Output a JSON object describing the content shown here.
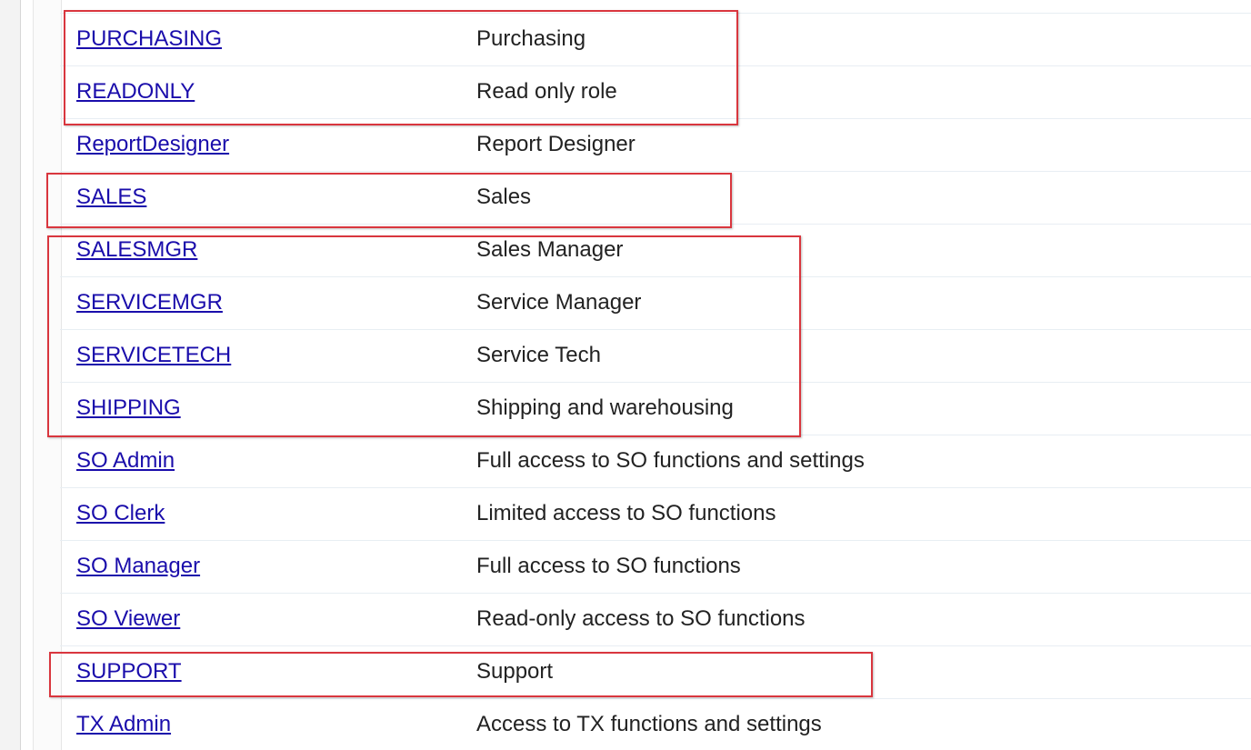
{
  "table": {
    "rows": [
      {
        "role": "PURCHASING",
        "description": "Purchasing"
      },
      {
        "role": "READONLY",
        "description": "Read only role"
      },
      {
        "role": "ReportDesigner",
        "description": "Report Designer"
      },
      {
        "role": "SALES",
        "description": "Sales"
      },
      {
        "role": "SALESMGR",
        "description": "Sales Manager"
      },
      {
        "role": "SERVICEMGR",
        "description": "Service Manager"
      },
      {
        "role": "SERVICETECH",
        "description": "Service Tech"
      },
      {
        "role": "SHIPPING",
        "description": "Shipping and warehousing"
      },
      {
        "role": "SO Admin",
        "description": "Full access to SO functions and settings"
      },
      {
        "role": "SO Clerk",
        "description": "Limited access to SO functions"
      },
      {
        "role": "SO Manager",
        "description": "Full access to SO functions"
      },
      {
        "role": "SO Viewer",
        "description": "Read-only access to SO functions"
      },
      {
        "role": "SUPPORT",
        "description": "Support"
      },
      {
        "role": "TX Admin",
        "description": "Access to TX functions and settings"
      }
    ]
  },
  "colors": {
    "link": "#1a0dab",
    "highlight_border": "#d9363e",
    "row_divider": "#e8eef3"
  }
}
